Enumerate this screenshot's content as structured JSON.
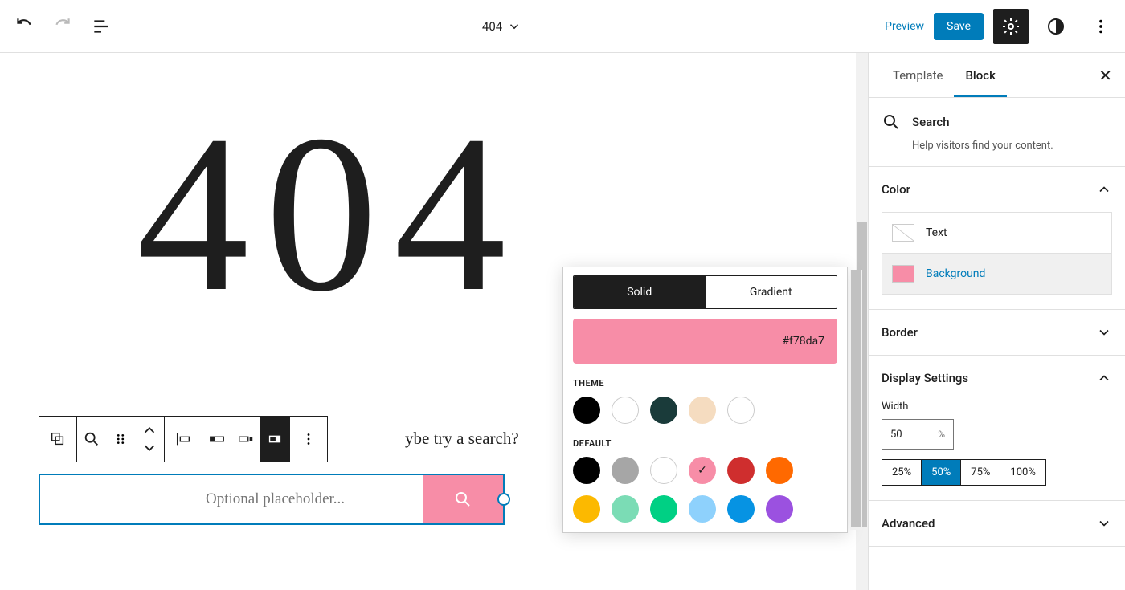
{
  "header": {
    "document_title": "404",
    "preview": "Preview",
    "save": "Save"
  },
  "canvas": {
    "big_text": "404",
    "prompt_tail": "ybe try a search?",
    "search_placeholder": "Optional placeholder..."
  },
  "color_popover": {
    "solid": "Solid",
    "gradient": "Gradient",
    "hex": "#f78da7",
    "theme_label": "THEME",
    "default_label": "DEFAULT",
    "theme_colors": [
      "#000000",
      "#ffffff",
      "#1a3b3a",
      "#f5dcc0",
      "#ffffff"
    ],
    "default_colors_row1": [
      "#000000",
      "#a6a6a6",
      "#ffffff",
      "#f78da7",
      "#cf2e2e",
      "#ff6900"
    ],
    "default_colors_row2": [
      "#fcb900",
      "#7bdcb5",
      "#00d084",
      "#8ed1fc",
      "#0693e3",
      "#9b51e0"
    ],
    "selected_default": "#f78da7"
  },
  "sidebar": {
    "tab_template": "Template",
    "tab_block": "Block",
    "block_name": "Search",
    "block_desc": "Help visitors find your content.",
    "sections": {
      "color": "Color",
      "border": "Border",
      "display": "Display Settings",
      "advanced": "Advanced"
    },
    "color_items": {
      "text": "Text",
      "background": "Background",
      "background_color": "#f78da7"
    },
    "width_label": "Width",
    "width_value": "50",
    "width_unit": "%",
    "width_options": [
      "25%",
      "50%",
      "75%",
      "100%"
    ],
    "width_selected": "50%"
  }
}
